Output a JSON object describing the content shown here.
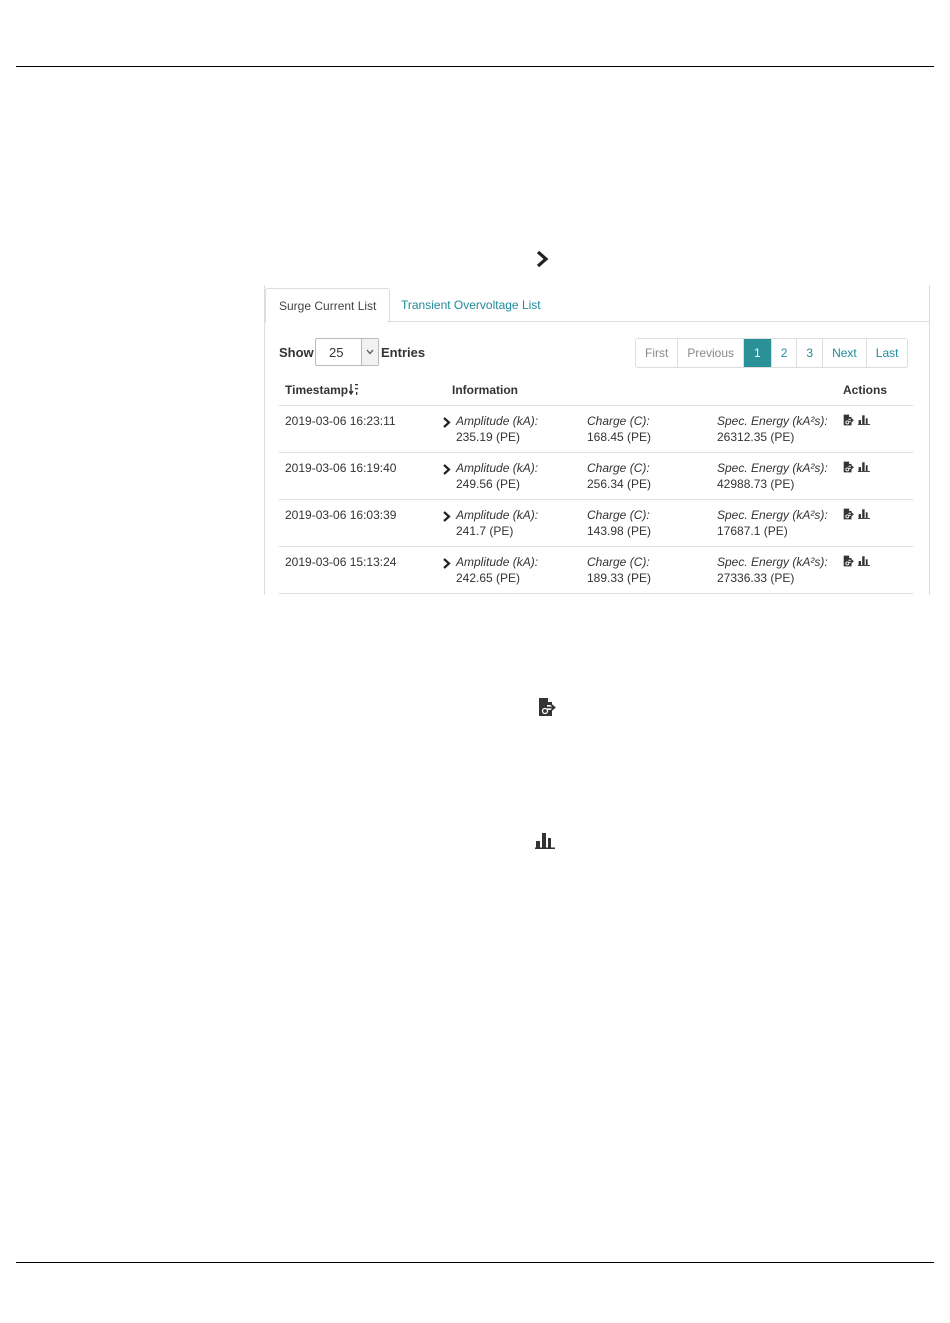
{
  "tabs": [
    {
      "label": "Surge Current List",
      "active": true
    },
    {
      "label": "Transient Overvoltage List",
      "active": false
    }
  ],
  "length_control": {
    "show_label": "Show",
    "value": "25",
    "entries_label": "Entries"
  },
  "pagination": {
    "first": "First",
    "previous": "Previous",
    "pages": [
      "1",
      "2",
      "3"
    ],
    "current": "1",
    "next": "Next",
    "last": "Last"
  },
  "table": {
    "headers": {
      "timestamp": "Timestamp",
      "information": "Information",
      "actions": "Actions"
    },
    "labels": {
      "amplitude": "Amplitude (kA):",
      "charge": "Charge (C):",
      "energy": "Spec. Energy (kA²s):"
    },
    "rows": [
      {
        "timestamp": "2019-03-06 16:23:11",
        "amplitude": "235.19 (PE)",
        "charge": "168.45 (PE)",
        "energy": "26312.35 (PE)"
      },
      {
        "timestamp": "2019-03-06 16:19:40",
        "amplitude": "249.56 (PE)",
        "charge": "256.34 (PE)",
        "energy": "42988.73 (PE)"
      },
      {
        "timestamp": "2019-03-06 16:03:39",
        "amplitude": "241.7 (PE)",
        "charge": "143.98 (PE)",
        "energy": "17687.1 (PE)"
      },
      {
        "timestamp": "2019-03-06 15:13:24",
        "amplitude": "242.65 (PE)",
        "charge": "189.33 (PE)",
        "energy": "27336.33 (PE)"
      }
    ]
  },
  "icons": {
    "expand": "chevron-right-icon",
    "export": "file-export-icon",
    "chart": "bar-chart-icon",
    "sort": "sort-descending-icon"
  },
  "colors": {
    "accent": "#2a9199",
    "link": "#1f8a99",
    "border": "#dddddd"
  }
}
